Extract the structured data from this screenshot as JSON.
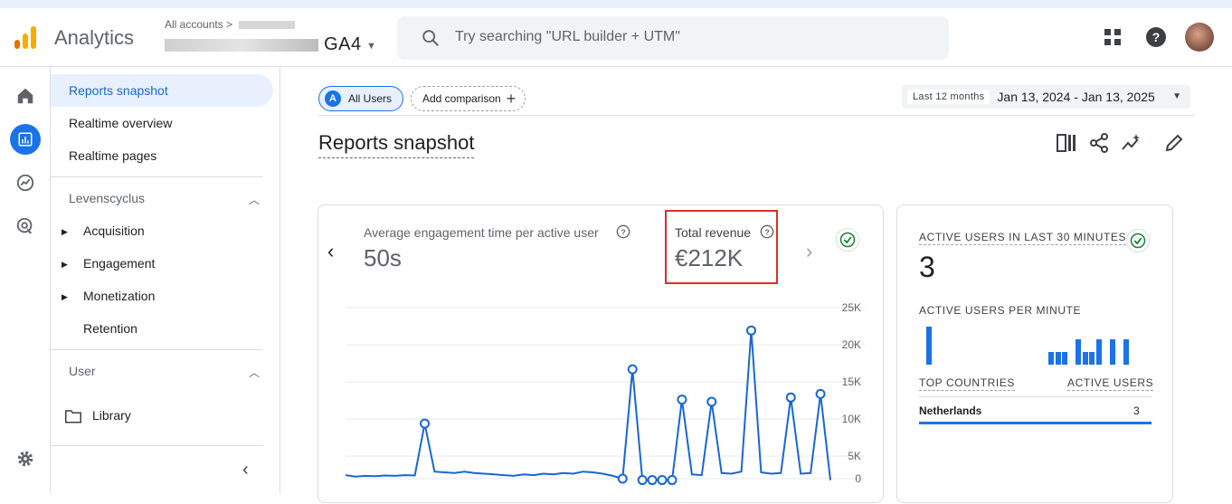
{
  "app": {
    "title": "Analytics"
  },
  "header": {
    "account_crumb": "All accounts",
    "property_suffix": "GA4",
    "search_placeholder": "Try searching \"URL builder + UTM\""
  },
  "nav": {
    "items": [
      "Reports snapshot",
      "Realtime overview",
      "Realtime pages"
    ],
    "section_lifecycle": "Levenscyclus",
    "lifecycle": [
      "Acquisition",
      "Engagement",
      "Monetization",
      "Retention"
    ],
    "section_user": "User",
    "library": "Library"
  },
  "toolbar": {
    "all_users_badge": "A",
    "all_users": "All Users",
    "add_comparison": "Add comparison",
    "date_tag": "Last 12 months",
    "date_range": "Jan 13, 2024 - Jan 13, 2025"
  },
  "page_title": "Reports snapshot",
  "metrics": {
    "engagement_label": "Average engagement time per active user",
    "engagement_value": "50s",
    "revenue_label": "Total revenue",
    "revenue_value": "€212K"
  },
  "realtime": {
    "title": "ACTIVE USERS IN LAST 30 MINUTES",
    "count": "3",
    "per_minute_label": "ACTIVE USERS PER MINUTE",
    "col_countries": "TOP COUNTRIES",
    "col_active": "ACTIVE USERS",
    "rows": [
      {
        "country": "Netherlands",
        "users": "3"
      }
    ],
    "per_minute": [
      3,
      0,
      0,
      0,
      0,
      0,
      0,
      0,
      0,
      0,
      0,
      0,
      0,
      0,
      0,
      0,
      0,
      0,
      1,
      1,
      1,
      0,
      2,
      1,
      1,
      2,
      0,
      2,
      0,
      2
    ]
  },
  "chart_data": {
    "type": "line",
    "title": "Total revenue",
    "y_ticks": [
      "25K",
      "20K",
      "15K",
      "10K",
      "5K",
      "0"
    ],
    "ylim": [
      0,
      25000
    ],
    "series": [
      {
        "values": [
          500,
          300,
          400,
          350,
          450,
          400,
          500,
          450,
          7800,
          1000,
          900,
          800,
          1000,
          800,
          700,
          600,
          500,
          400,
          600,
          500,
          700,
          600,
          800,
          700,
          1000,
          900,
          700,
          400,
          0,
          15500,
          -200,
          -200,
          -200,
          -200,
          11200,
          600,
          500,
          10900,
          800,
          700,
          1000,
          21000,
          900,
          700,
          800,
          11500,
          700,
          800,
          12000,
          -200
        ],
        "marked": [
          8,
          28,
          29,
          30,
          31,
          32,
          33,
          34,
          37,
          41,
          45,
          48
        ]
      }
    ],
    "colors": {
      "line": "#1967d2",
      "grid": "#e8eaed"
    }
  },
  "colors": {
    "accent": "#1a73e8",
    "alert_box": "#d93025",
    "check": "#188038"
  }
}
